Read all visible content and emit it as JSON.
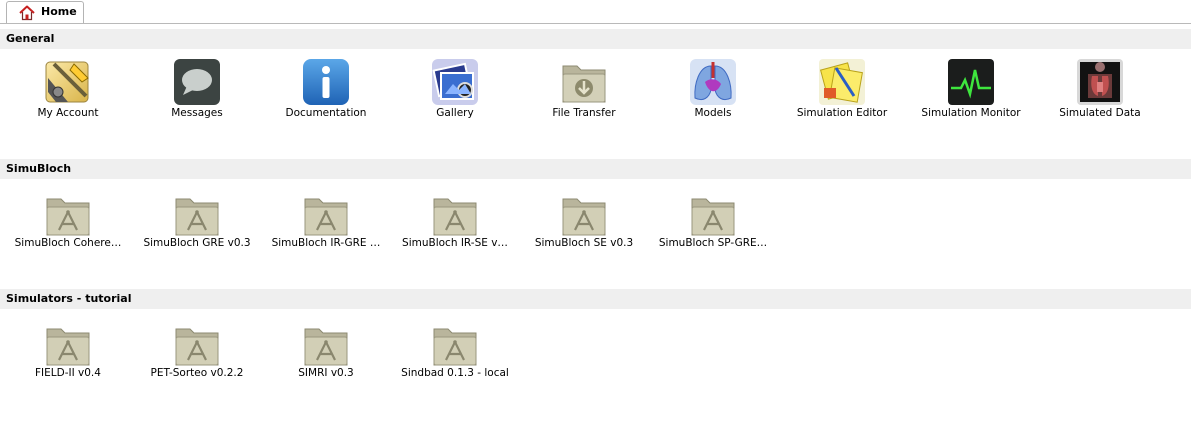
{
  "tab": {
    "label": "Home",
    "icon": "home-icon"
  },
  "sections": [
    {
      "title": "General",
      "items": [
        {
          "label": "My Account",
          "icon": "account-tools-icon"
        },
        {
          "label": "Messages",
          "icon": "speech-bubble-icon"
        },
        {
          "label": "Documentation",
          "icon": "info-icon"
        },
        {
          "label": "Gallery",
          "icon": "image-gallery-icon"
        },
        {
          "label": "File Transfer",
          "icon": "download-folder-icon"
        },
        {
          "label": "Models",
          "icon": "lungs-model-icon"
        },
        {
          "label": "Simulation Editor",
          "icon": "notes-editor-icon"
        },
        {
          "label": "Simulation Monitor",
          "icon": "heartbeat-monitor-icon"
        },
        {
          "label": "Simulated Data",
          "icon": "anatomy-scan-icon"
        }
      ]
    },
    {
      "title": "SimuBloch",
      "items": [
        {
          "label": "SimuBloch Cohere…",
          "icon": "app-folder-icon"
        },
        {
          "label": "SimuBloch GRE v0.3",
          "icon": "app-folder-icon"
        },
        {
          "label": "SimuBloch IR-GRE …",
          "icon": "app-folder-icon"
        },
        {
          "label": "SimuBloch IR-SE v…",
          "icon": "app-folder-icon"
        },
        {
          "label": "SimuBloch SE v0.3",
          "icon": "app-folder-icon"
        },
        {
          "label": "SimuBloch SP-GRE…",
          "icon": "app-folder-icon"
        }
      ]
    },
    {
      "title": "Simulators - tutorial",
      "items": [
        {
          "label": "FIELD-II v0.4",
          "icon": "app-folder-icon"
        },
        {
          "label": "PET-Sorteo v0.2.2",
          "icon": "app-folder-icon"
        },
        {
          "label": "SIMRI v0.3",
          "icon": "app-folder-icon"
        },
        {
          "label": "Sindbad 0.1.3 - local",
          "icon": "app-folder-icon"
        }
      ]
    }
  ]
}
